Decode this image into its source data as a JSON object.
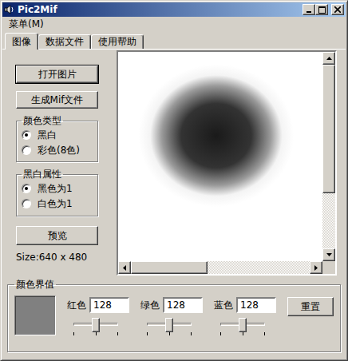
{
  "window": {
    "title": "Pic2Mif"
  },
  "menu": [
    {
      "label": "菜单(M)"
    }
  ],
  "tabs": [
    {
      "label": "图像",
      "selected": true
    },
    {
      "label": "数据文件",
      "selected": false
    },
    {
      "label": "使用帮助",
      "selected": false
    }
  ],
  "buttons": {
    "open": "打开图片",
    "generate": "生成Mif文件",
    "preview": "预览",
    "reset": "重置"
  },
  "color_type": {
    "title": "颜色类型",
    "options": [
      {
        "label": "黑白",
        "selected": true
      },
      {
        "label": "彩色(8色)",
        "selected": false
      }
    ]
  },
  "bw_property": {
    "title": "黑白属性",
    "options": [
      {
        "label": "黑色为1",
        "selected": true
      },
      {
        "label": "白色为1",
        "selected": false
      }
    ]
  },
  "size_text": "Size:640 x 480",
  "preview": {
    "scrollbars": [
      {
        "orientation": "vertical",
        "thumb_start": 0.0,
        "thumb_share": 0.7
      },
      {
        "orientation": "horizontal",
        "thumb_start": 0.0,
        "thumb_share": 0.43
      }
    ]
  },
  "threshold": {
    "title": "颜色界值",
    "swatch_color": "#808080",
    "channels": [
      {
        "label": "红色",
        "value": "128",
        "level": 0.5
      },
      {
        "label": "绿色",
        "value": "128",
        "level": 0.5
      },
      {
        "label": "蓝色",
        "value": "128",
        "level": 0.5
      }
    ]
  }
}
